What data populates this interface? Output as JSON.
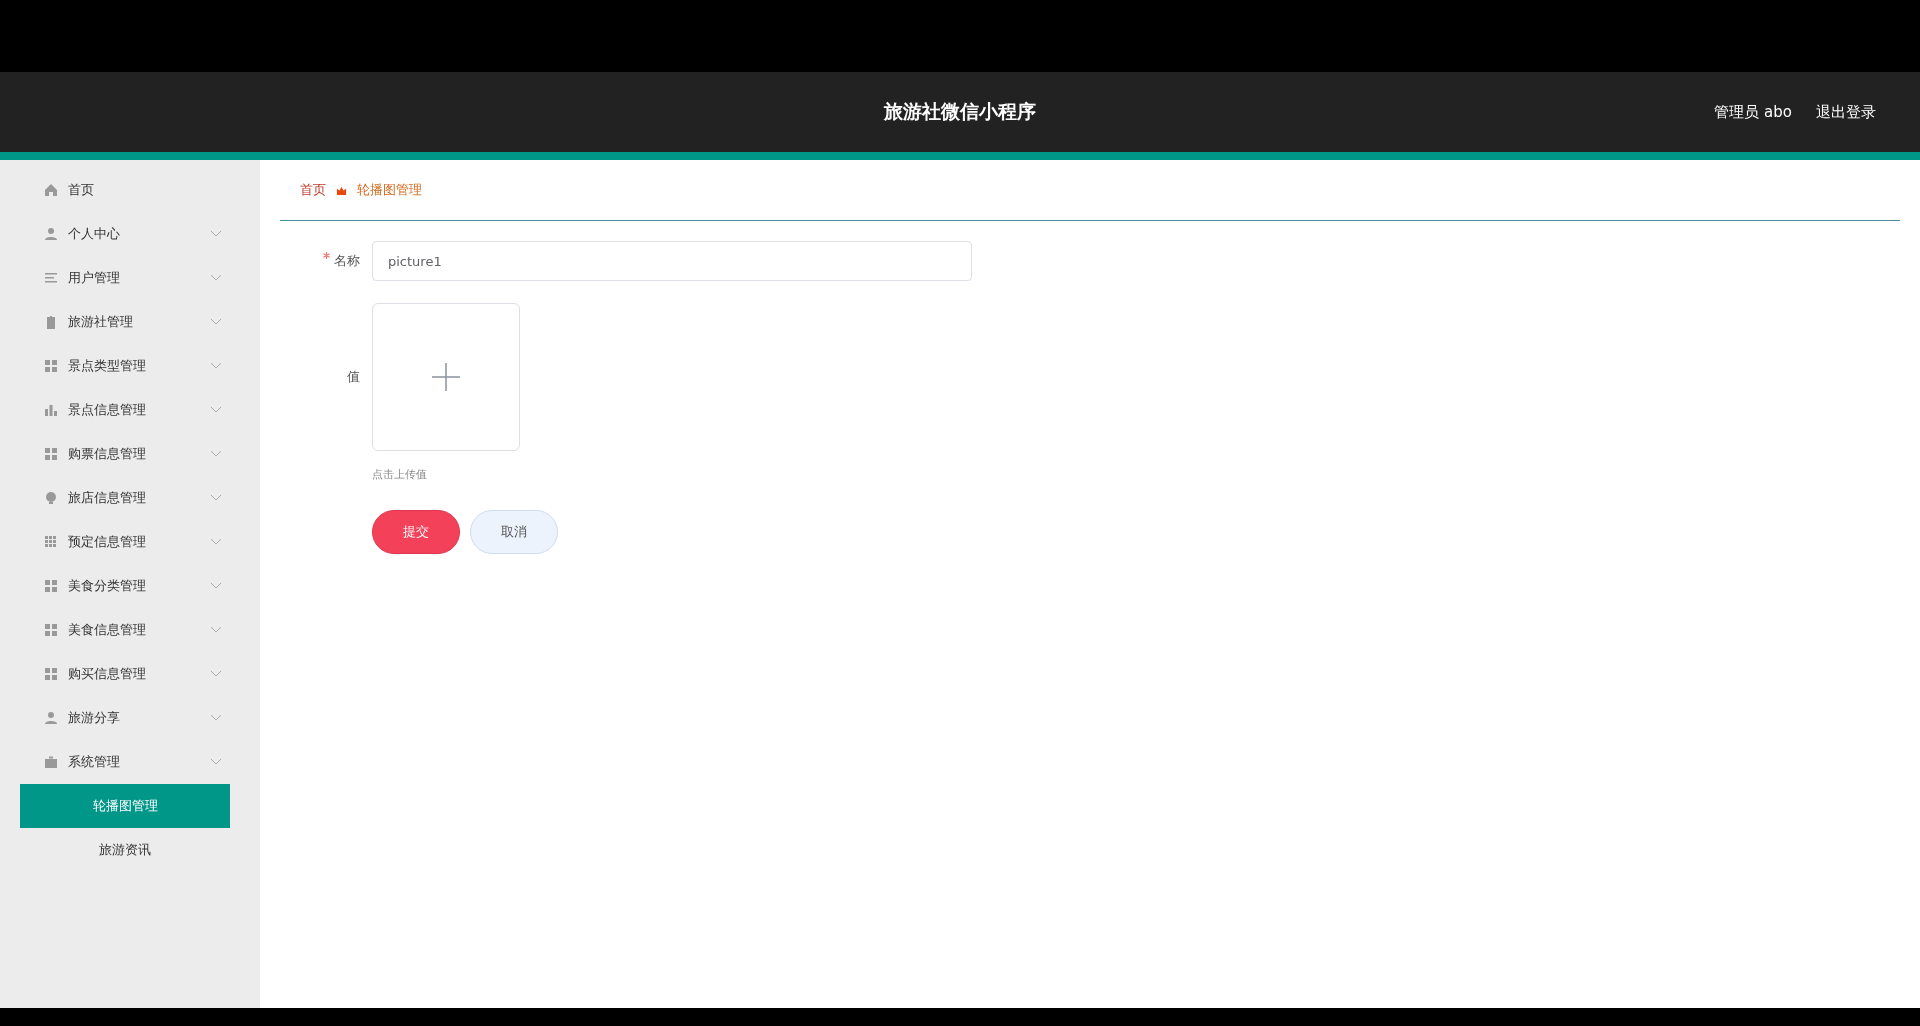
{
  "header": {
    "title": "旅游社微信小程序",
    "user": "管理员 abo",
    "logout": "退出登录"
  },
  "sidebar": {
    "items": [
      {
        "label": "首页",
        "kind": "link"
      },
      {
        "label": "个人中心",
        "kind": "submenu"
      },
      {
        "label": "用户管理",
        "kind": "submenu"
      },
      {
        "label": "旅游社管理",
        "kind": "submenu"
      },
      {
        "label": "景点类型管理",
        "kind": "submenu"
      },
      {
        "label": "景点信息管理",
        "kind": "submenu"
      },
      {
        "label": "购票信息管理",
        "kind": "submenu"
      },
      {
        "label": "旅店信息管理",
        "kind": "submenu"
      },
      {
        "label": "预定信息管理",
        "kind": "submenu"
      },
      {
        "label": "美食分类管理",
        "kind": "submenu"
      },
      {
        "label": "美食信息管理",
        "kind": "submenu"
      },
      {
        "label": "购买信息管理",
        "kind": "submenu"
      },
      {
        "label": "旅游分享",
        "kind": "submenu"
      },
      {
        "label": "系统管理",
        "kind": "submenu",
        "children": [
          {
            "label": "轮播图管理",
            "selected": true
          },
          {
            "label": "旅游资讯",
            "selected": false
          }
        ]
      }
    ]
  },
  "breadcrumb": [
    "首页",
    "轮播图管理"
  ],
  "form": {
    "name": {
      "label": "名称",
      "required": true,
      "value": "picture1"
    },
    "value": {
      "label": "值",
      "hint": "点击上传值"
    },
    "buttons": [
      {
        "label": "提交",
        "kind": "primary"
      },
      {
        "label": "取消",
        "kind": "secondary"
      }
    ]
  }
}
